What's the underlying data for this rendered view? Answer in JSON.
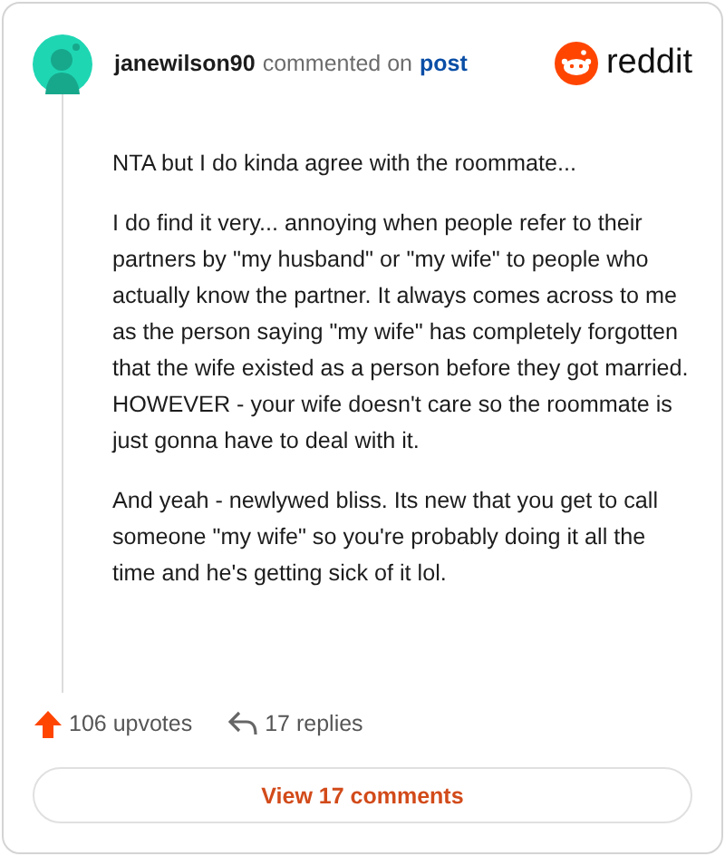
{
  "header": {
    "username": "janewilson90",
    "action": "commented on",
    "link": "post",
    "brand": "reddit"
  },
  "comment": {
    "paragraphs": [
      "NTA but I do kinda agree with the roommate...",
      "I do find it very... annoying when people refer to their partners by \"my husband\" or \"my wife\" to people who actually know the partner. It always comes across to me as the person saying \"my wife\" has completely forgotten that the wife existed as a person before they got married. HOWEVER - your wife doesn't care so the roommate is just gonna have to deal with it.",
      "And yeah - newlywed bliss. Its new that you get to call someone \"my wife\" so you're probably doing it all the time and he's getting sick of it lol."
    ]
  },
  "stats": {
    "upvotes": "106 upvotes",
    "replies": "17 replies"
  },
  "button": "View 17 comments"
}
